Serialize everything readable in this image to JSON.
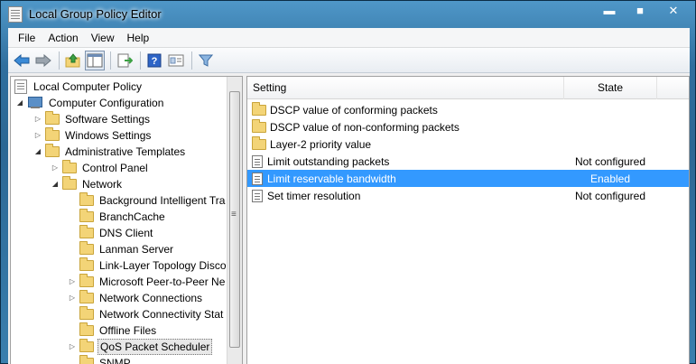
{
  "window": {
    "title": "Local Group Policy Editor",
    "buttons": {
      "minimize": "▬",
      "maximize": "■",
      "close": "✕"
    }
  },
  "menu": [
    "File",
    "Action",
    "View",
    "Help"
  ],
  "toolbar": {
    "icons": [
      "back-arrow-icon",
      "forward-arrow-icon",
      "up-folder-icon",
      "show-hide-tree-icon",
      "export-list-icon",
      "help-icon",
      "properties-icon",
      "filter-icon"
    ]
  },
  "tree": {
    "items": [
      {
        "label": "Local Computer Policy",
        "icon": "document-icon",
        "level": 0,
        "expander": "none"
      },
      {
        "label": "Computer Configuration",
        "icon": "computer-icon",
        "level": 1,
        "expander": "open"
      },
      {
        "label": "Software Settings",
        "icon": "folder-icon",
        "level": 2,
        "expander": "closed"
      },
      {
        "label": "Windows Settings",
        "icon": "folder-icon",
        "level": 2,
        "expander": "closed"
      },
      {
        "label": "Administrative Templates",
        "icon": "folder-icon",
        "level": 2,
        "expander": "open"
      },
      {
        "label": "Control Panel",
        "icon": "folder-icon",
        "level": 3,
        "expander": "closed"
      },
      {
        "label": "Network",
        "icon": "folder-icon",
        "level": 3,
        "expander": "open"
      },
      {
        "label": "Background Intelligent Tra",
        "icon": "folder-icon",
        "level": 4,
        "expander": "none"
      },
      {
        "label": "BranchCache",
        "icon": "folder-icon",
        "level": 4,
        "expander": "none"
      },
      {
        "label": "DNS Client",
        "icon": "folder-icon",
        "level": 4,
        "expander": "none"
      },
      {
        "label": "Lanman Server",
        "icon": "folder-icon",
        "level": 4,
        "expander": "none"
      },
      {
        "label": "Link-Layer Topology Disco",
        "icon": "folder-icon",
        "level": 4,
        "expander": "none"
      },
      {
        "label": "Microsoft Peer-to-Peer Ne",
        "icon": "folder-icon",
        "level": 4,
        "expander": "closed"
      },
      {
        "label": "Network Connections",
        "icon": "folder-icon",
        "level": 4,
        "expander": "closed"
      },
      {
        "label": "Network Connectivity Stat",
        "icon": "folder-icon",
        "level": 4,
        "expander": "none"
      },
      {
        "label": "Offline Files",
        "icon": "folder-icon",
        "level": 4,
        "expander": "none"
      },
      {
        "label": "QoS Packet Scheduler",
        "icon": "folder-icon",
        "level": 4,
        "expander": "closed",
        "selected": true
      },
      {
        "label": "SNMP",
        "icon": "folder-icon",
        "level": 4,
        "expander": "none"
      }
    ]
  },
  "list": {
    "columns": {
      "setting": "Setting",
      "state": "State"
    },
    "rows": [
      {
        "name": "DSCP value of conforming packets",
        "state": "",
        "icon": "folder-icon"
      },
      {
        "name": "DSCP value of non-conforming packets",
        "state": "",
        "icon": "folder-icon"
      },
      {
        "name": "Layer-2 priority value",
        "state": "",
        "icon": "folder-icon"
      },
      {
        "name": "Limit outstanding packets",
        "state": "Not configured",
        "icon": "setting-icon"
      },
      {
        "name": "Limit reservable bandwidth",
        "state": "Enabled",
        "icon": "setting-icon",
        "selected": true
      },
      {
        "name": "Set timer resolution",
        "state": "Not configured",
        "icon": "setting-icon"
      }
    ]
  }
}
